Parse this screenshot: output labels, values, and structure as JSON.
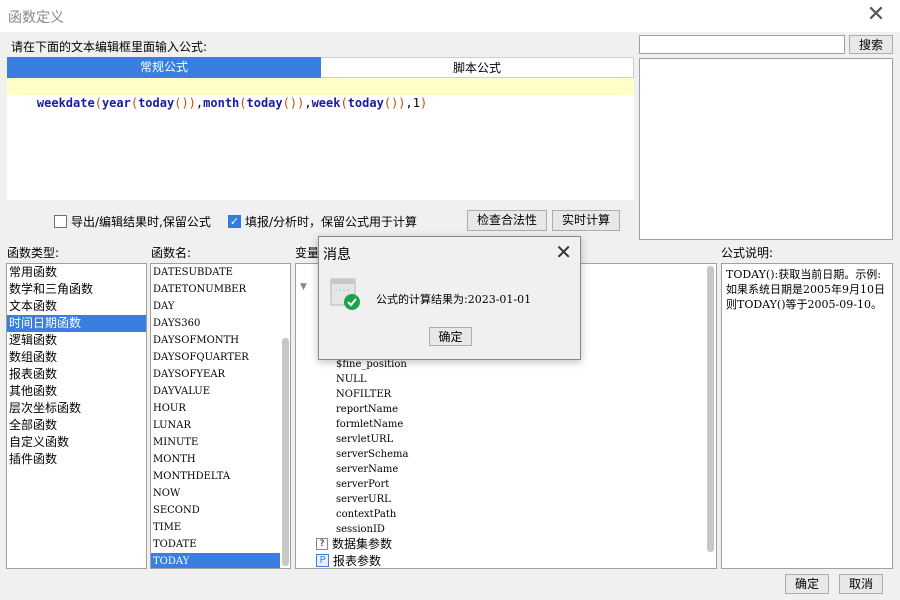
{
  "window": {
    "title": "函数定义",
    "close_glyph": "✕"
  },
  "search": {
    "value": "",
    "placeholder": "",
    "button_label": "搜索"
  },
  "editor": {
    "prompt_label": "请在下面的文本编辑框里面输入公式:",
    "tabs": [
      "常规公式",
      "脚本公式"
    ],
    "formula": "weekdate(year(today()),month(today()),week(today()),1)"
  },
  "options": {
    "keep_formula_export": {
      "label": "导出/编辑结果时,保留公式",
      "checked": false
    },
    "keep_formula_fill": {
      "label": "填报/分析时，保留公式用于计算",
      "checked": true
    },
    "check_button": "检查合法性",
    "realtime_button": "实时计算"
  },
  "function_types": {
    "label": "函数类型:",
    "items": [
      "常用函数",
      "数学和三角函数",
      "文本函数",
      "时间日期函数",
      "逻辑函数",
      "数组函数",
      "报表函数",
      "其他函数",
      "层次坐标函数",
      "全部函数",
      "自定义函数",
      "插件函数"
    ],
    "selected": "时间日期函数"
  },
  "function_names": {
    "label": "函数名:",
    "items": [
      "DATESUBDATE",
      "DATETONUMBER",
      "DAY",
      "DAYS360",
      "DAYSOFMONTH",
      "DAYSOFQUARTER",
      "DAYSOFYEAR",
      "DAYVALUE",
      "HOUR",
      "LUNAR",
      "MINUTE",
      "MONTH",
      "MONTHDELTA",
      "NOW",
      "SECOND",
      "TIME",
      "TODATE",
      "TODAY"
    ],
    "selected": "TODAY"
  },
  "variables": {
    "label": "变量",
    "items": [
      "$fine_position",
      "NULL",
      "NOFILTER",
      "reportName",
      "formletName",
      "servletURL",
      "serverSchema",
      "serverName",
      "serverPort",
      "serverURL",
      "contextPath",
      "sessionID"
    ],
    "group_dataset": "数据集参数",
    "group_report": "报表参数"
  },
  "description": {
    "label": "公式说明:",
    "text": "TODAY():获取当前日期。示例:如果系统日期是2005年9月10日则TODAY()等于2005-09-10。"
  },
  "footer": {
    "ok": "确定",
    "cancel": "取消"
  },
  "message_dialog": {
    "title": "消息",
    "close_glyph": "✕",
    "text_prefix": "公式的计算结果为:",
    "result": "2023-01-01",
    "ok_button": "确定",
    "icon": "success-check-icon"
  },
  "colors": {
    "accent": "#3a7ee0",
    "editor_highlight": "#ffffc8",
    "success": "#1aa34a"
  }
}
